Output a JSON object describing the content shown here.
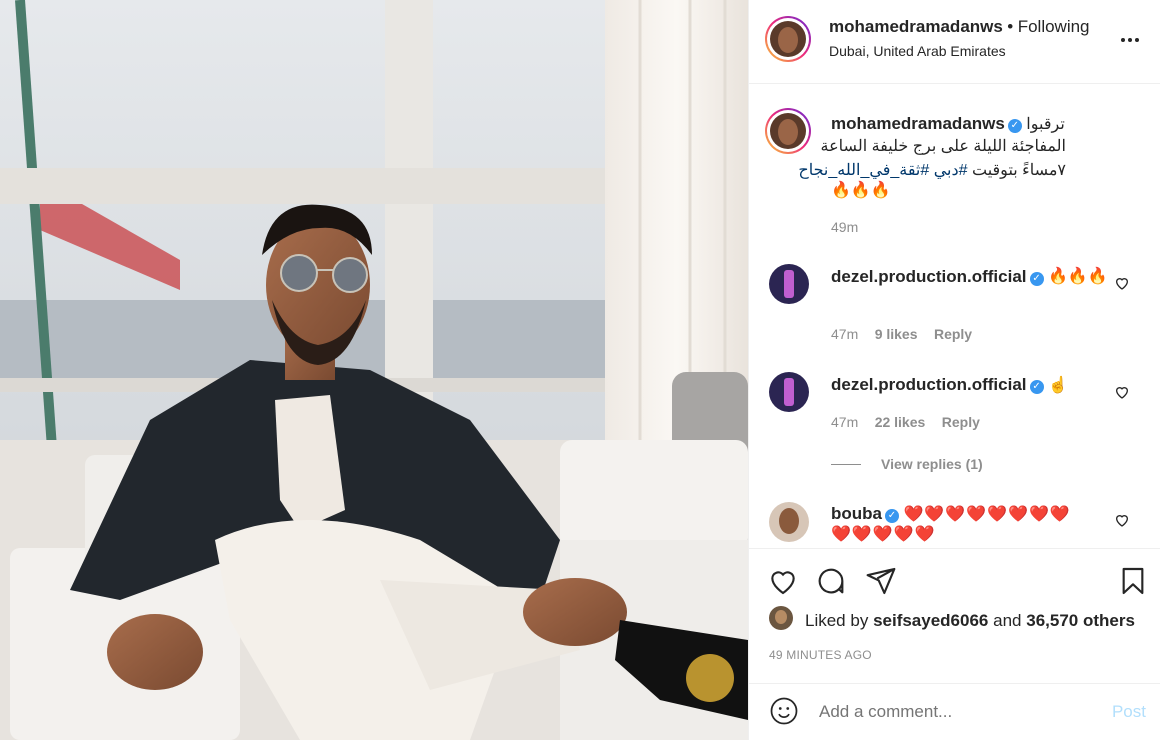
{
  "header": {
    "username": "mohamedramadanws",
    "separator": "•",
    "follow_state": "Following",
    "location": "Dubai, United Arab Emirates",
    "more_icon": "more-horizontal-icon"
  },
  "caption": {
    "username": "mohamedramadanws",
    "line1": "ترقبوا",
    "line2": "المفاجئة الليلة على برج خليفة الساعة",
    "line3_text": "٧مساءً بتوقيت",
    "hashtag1": "#دبي",
    "hashtag2": "#ثقة_في_الله_نجاح",
    "emojis": "🔥🔥🔥",
    "time": "49m"
  },
  "comments": [
    {
      "username": "dezel.production.official",
      "text": "🔥🔥🔥",
      "time": "47m",
      "likes": "9 likes",
      "reply": "Reply"
    },
    {
      "username": "dezel.production.official",
      "text": "☝️",
      "time": "47m",
      "likes": "22 likes",
      "reply": "Reply",
      "view_replies": "View replies (1)"
    },
    {
      "username": "bouba",
      "text": "❤️❤️❤️❤️❤️❤️❤️❤️❤️❤️❤️❤️❤️"
    }
  ],
  "actions": {
    "like_icon": "heart-icon",
    "comment_icon": "comment-icon",
    "share_icon": "paper-plane-icon",
    "save_icon": "bookmark-icon"
  },
  "likes": {
    "prefix": "Liked by",
    "liker": "seifsayed6066",
    "and": "and",
    "others": "36,570 others"
  },
  "timestamp": "49 MINUTES AGO",
  "comment_box": {
    "placeholder": "Add a comment...",
    "post_label": "Post",
    "emoji_icon": "smiley-icon"
  },
  "colors": {
    "accent": "#0095f6",
    "verified": "#3897f0",
    "muted": "#8e8e8e",
    "heart_red": "#e0112b"
  }
}
